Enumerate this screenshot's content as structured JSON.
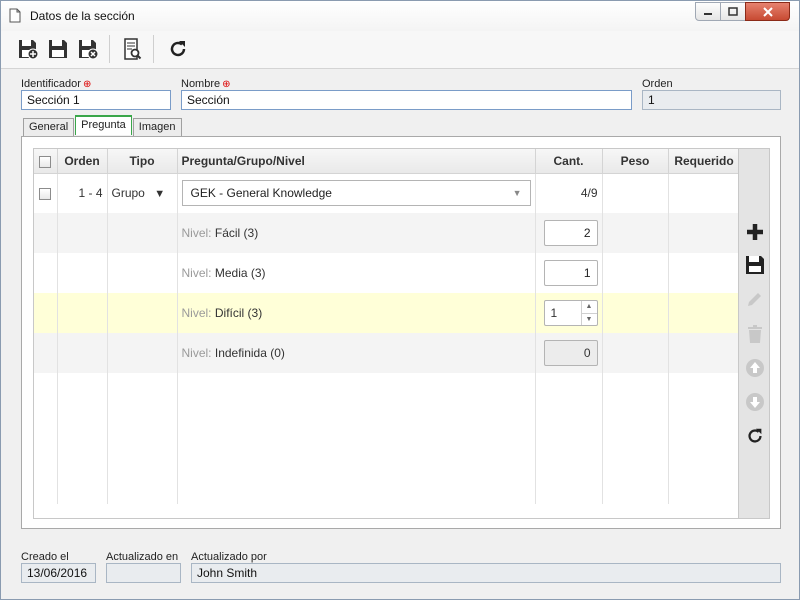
{
  "window": {
    "title": "Datos de la sección",
    "icons": {
      "document": "document-icon",
      "minimize": "minimize-icon",
      "maximize": "maximize-icon",
      "close": "close-icon"
    }
  },
  "toolbar": {
    "buttons": [
      {
        "name": "save-new-button",
        "icon": "save-new-icon"
      },
      {
        "name": "save-button",
        "icon": "save-icon"
      },
      {
        "name": "save-close-button",
        "icon": "save-close-icon"
      },
      {
        "name": "preview-button",
        "icon": "document-search-icon"
      },
      {
        "name": "refresh-button",
        "icon": "refresh-icon"
      }
    ]
  },
  "form": {
    "identificador": {
      "label": "Identificador",
      "value": "Sección 1"
    },
    "nombre": {
      "label": "Nombre",
      "value": "Sección"
    },
    "orden": {
      "label": "Orden",
      "value": "1"
    }
  },
  "tabs": [
    {
      "label": "General",
      "active": false
    },
    {
      "label": "Pregunta",
      "active": true
    },
    {
      "label": "Imagen",
      "active": false
    }
  ],
  "grid": {
    "columns": [
      "Orden",
      "Tipo",
      "Pregunta/Grupo/Nivel",
      "Cant.",
      "Peso",
      "Requerido"
    ],
    "main_row": {
      "orden": "1 - 4",
      "tipo": "Grupo",
      "tipo_arrow": "▼",
      "pregunta": "GEK - General Knowledge",
      "cant": "4/9"
    },
    "nivel_prefix": "Nivel:",
    "levels": [
      {
        "label": "Fácil (3)",
        "value": "2"
      },
      {
        "label": "Media (3)",
        "value": "1"
      },
      {
        "label": "Difícil (3)",
        "value": "1"
      },
      {
        "label": "Indefinida (0)",
        "value": "0"
      }
    ]
  },
  "side_toolbar": [
    "add-icon",
    "save-icon",
    "edit-icon",
    "delete-icon",
    "move-up-icon",
    "move-down-icon",
    "refresh-icon"
  ],
  "footer": {
    "creado_el": {
      "label": "Creado el",
      "value": "13/06/2016"
    },
    "actualizado_en": {
      "label": "Actualizado en",
      "value": ""
    },
    "actualizado_por": {
      "label": "Actualizado por",
      "value": "John Smith"
    }
  },
  "colors": {
    "accent_green": "#3aa64a",
    "selected_row": "#ffffd8",
    "required_red": "#dd0000"
  }
}
